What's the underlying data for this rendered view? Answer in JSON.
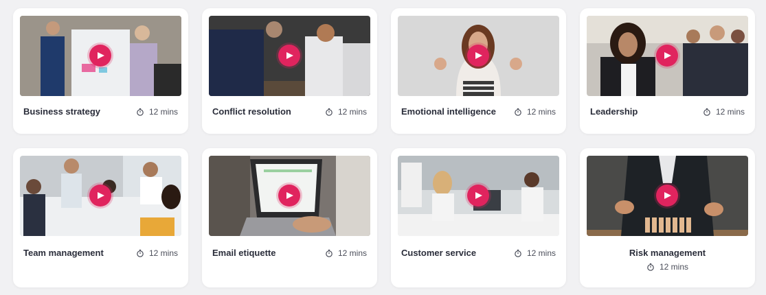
{
  "courses": [
    {
      "title": "Business strategy",
      "duration": "12 mins"
    },
    {
      "title": "Conflict resolution",
      "duration": "12 mins"
    },
    {
      "title": "Emotional intelligence",
      "duration": "12 mins"
    },
    {
      "title": "Leadership",
      "duration": "12 mins"
    },
    {
      "title": "Team management",
      "duration": "12 mins"
    },
    {
      "title": "Email etiquette",
      "duration": "12 mins"
    },
    {
      "title": "Customer service",
      "duration": "12 mins"
    },
    {
      "title": "Risk management",
      "duration": "12 mins"
    }
  ],
  "colors": {
    "accent": "#e0245e",
    "card_bg": "#ffffff",
    "page_bg": "#f1f1f3",
    "title_text": "#2a2d3a"
  },
  "icons": {
    "play": "play-icon",
    "clock": "stopwatch-icon"
  }
}
